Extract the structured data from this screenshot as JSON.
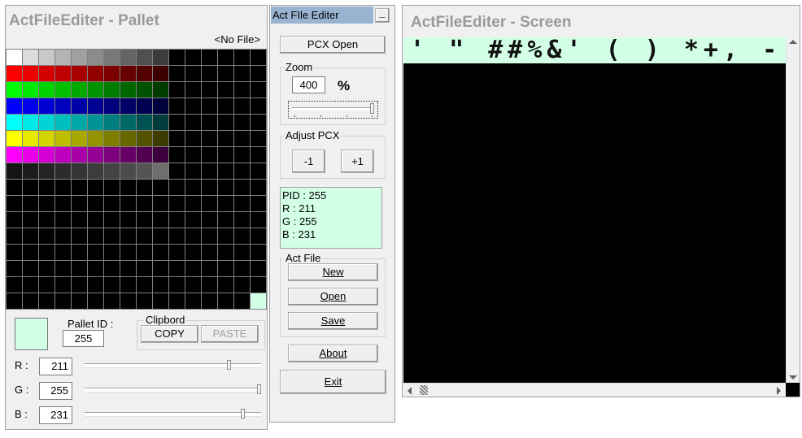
{
  "pallet": {
    "title": "ActFileEditer - Pallet",
    "file": "<No File>",
    "pallet_id_label": "Pallet ID :",
    "pallet_id": "255",
    "clipboard_label": "Clipbord",
    "copy_label": "COPY",
    "paste_label": "PASTE",
    "r_label": "R :",
    "g_label": "G :",
    "b_label": "B :",
    "r": "211",
    "g": "255",
    "b": "231",
    "r_level": 0.827,
    "g_level": 1.0,
    "b_level": 0.906,
    "swatch_color": "#d3ffe7"
  },
  "control": {
    "title": "Act FIle Editer",
    "minimize_label": "_",
    "pcx_open_label": "PCX Open",
    "zoom_label": "Zoom",
    "zoom_value": "400",
    "zoom_unit": "%",
    "adjust_label": "Adjust PCX",
    "minus_label": "-1",
    "plus_label": "+1",
    "info_pid": "PID : 255",
    "info_r": "R : 211",
    "info_g": "G : 255",
    "info_b": "B : 231",
    "act_file_label": "Act File",
    "new_label": "New",
    "open_label": "Open",
    "save_label": "Save",
    "about_label": "About",
    "exit_label": "Exit"
  },
  "screen": {
    "title": "ActFileEditer - Screen",
    "glyph_strip": "' \" ##%&' ( ) *+, -. /",
    "strip_color": "#d3ffe7"
  }
}
